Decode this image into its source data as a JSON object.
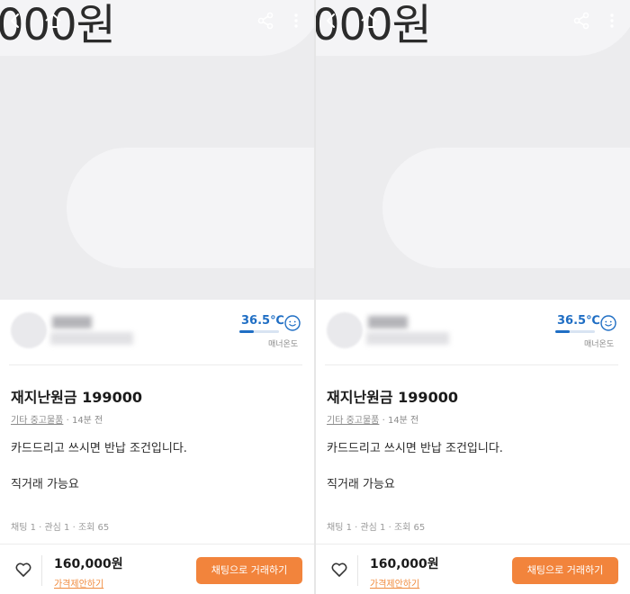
{
  "hero": {
    "text": "000원"
  },
  "icons": {
    "back": "arrow-back-icon",
    "home": "home-icon",
    "share": "share-icon",
    "more": "more-vertical-icon",
    "heart": "heart-icon",
    "temperature_face": "smile-face-icon"
  },
  "seller": {
    "temperature": "36.5℃",
    "temperature_fraction": 0.365,
    "temperature_caption": "매너온도"
  },
  "post": {
    "title": "재지난원금 199000",
    "category": "기타 중고물품",
    "separator": "·",
    "time_ago": "14분 전",
    "description_lines": [
      "카드드리고 쓰시면 반납 조건입니다.",
      "직거래 가능요"
    ],
    "stats": "채팅 1 · 관심 1 · 조회 65"
  },
  "bottom_bar": {
    "price": "160,000원",
    "offer_link": "가격제안하기",
    "chat_button": "채팅으로 거래하기"
  },
  "colors": {
    "accent_orange": "#f2843c",
    "temperature_blue": "#1f6ec4"
  }
}
